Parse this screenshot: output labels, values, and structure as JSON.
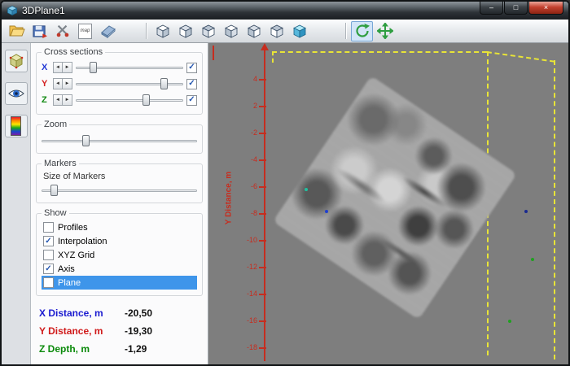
{
  "window": {
    "title": "3DPlane1",
    "controls": {
      "minimize": "–",
      "maximize": "□",
      "close": "×"
    }
  },
  "toolbar": {
    "map_icon_text": "map",
    "button_names": [
      "open-project",
      "save-export",
      "tools",
      "map-notes",
      "eraser",
      "cube-view-1",
      "cube-view-2",
      "cube-view-3",
      "cube-view-4",
      "cube-view-5",
      "cube-view-6",
      "cube-view-solid",
      "rotate-mode",
      "pan-mode"
    ],
    "active_button": "rotate-mode"
  },
  "sidebar": {
    "button_names": [
      "box-3d",
      "visibility-eye",
      "color-scale"
    ]
  },
  "icons": {
    "spin_left": "◄",
    "spin_right": "►"
  },
  "colors": {
    "view_background": "#7e7e7e",
    "axis_red": "#c62d1f",
    "grid_yellow": "#e8e437",
    "selection_blue": "#3e95ea",
    "x_label": "#1a1ad0",
    "y_label": "#d01a1a",
    "z_label": "#0a8a0a"
  },
  "panel": {
    "cross_sections": {
      "caption": "Cross sections",
      "axes": [
        {
          "label": "X",
          "checked": "✓"
        },
        {
          "label": "Y",
          "checked": "✓"
        },
        {
          "label": "Z",
          "checked": "✓"
        }
      ]
    },
    "zoom": {
      "caption": "Zoom"
    },
    "markers": {
      "caption": "Markers",
      "size_label": "Size of Markers"
    },
    "show": {
      "caption": "Show",
      "items": [
        {
          "label": "Profiles",
          "mark": "",
          "selected": false
        },
        {
          "label": "Interpolation",
          "mark": "✓",
          "selected": false
        },
        {
          "label": "XYZ Grid",
          "mark": "",
          "selected": false
        },
        {
          "label": "Axis",
          "mark": "✓",
          "selected": false
        },
        {
          "label": "Plane",
          "mark": "",
          "selected": true
        }
      ]
    },
    "readouts": [
      {
        "label": "X Distance, m",
        "value": "-20,50"
      },
      {
        "label": "Y Distance, m",
        "value": "-19,30"
      },
      {
        "label": "Z Depth, m",
        "value": "-1,29"
      }
    ]
  },
  "view": {
    "y_axis_label": "Y Distance, m",
    "y_ticks": [
      "4",
      "2",
      "-2",
      "-4",
      "-6",
      "-8",
      "-10",
      "-12",
      "-14",
      "-16",
      "-18"
    ]
  }
}
